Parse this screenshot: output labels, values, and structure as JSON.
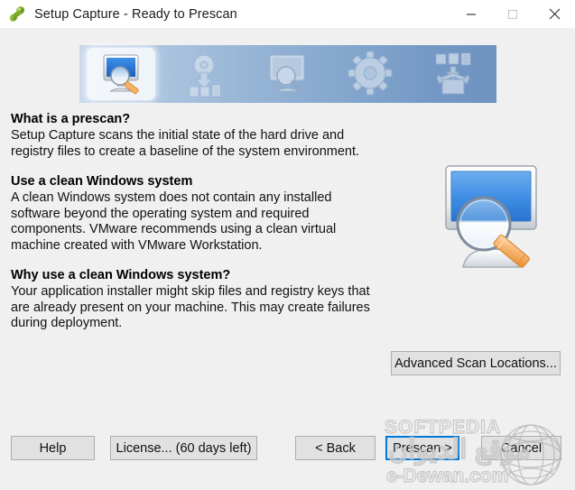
{
  "window": {
    "title": "Setup Capture - Ready to Prescan",
    "app_icon": "capture-peanut-icon",
    "controls": {
      "minimize": "minimize-icon",
      "maximize": "maximize-icon",
      "close": "close-icon"
    }
  },
  "banner": {
    "steps": [
      {
        "id": "prescan",
        "icon": "monitor-magnifier-pencil-icon",
        "active": true
      },
      {
        "id": "install",
        "icon": "disc-download-files-icon",
        "active": false
      },
      {
        "id": "postscan",
        "icon": "monitor-magnifier-icon",
        "active": false
      },
      {
        "id": "configure",
        "icon": "gear-icon",
        "active": false
      },
      {
        "id": "package",
        "icon": "box-files-icon",
        "active": false
      }
    ]
  },
  "content": {
    "sections": [
      {
        "heading": "What is a prescan?",
        "body": "Setup Capture scans the initial state of the hard drive and registry files to create a baseline of the system environment."
      },
      {
        "heading": "Use a clean Windows system",
        "body": "A clean Windows system does not contain any installed software beyond the operating system and required components. VMware recommends using a clean virtual machine created with VMware Workstation."
      },
      {
        "heading": "Why use a clean Windows system?",
        "body": "Your application installer might skip files and registry keys that are already present on your machine. This may create failures during deployment."
      }
    ],
    "hero_icon": "monitor-magnifier-pencil-large-icon"
  },
  "buttons": {
    "advanced_scan_locations": "Advanced Scan Locations...",
    "help": "Help",
    "license": "License... (60 days left)",
    "back": "< Back",
    "prescan": "Prescan >",
    "cancel": "Cancel"
  },
  "focus": {
    "element": "prescan-button",
    "color": "#0078d7"
  },
  "watermark": {
    "brand": "SOFTPEDIA",
    "site": "e-Dewan.com",
    "logo": "globe-icon"
  },
  "colors": {
    "window_background": "#f0f0f0",
    "titlebar_background": "#ffffff",
    "banner_left": "#c9d8ea",
    "banner_right": "#6e93c1",
    "button_face": "#e1e1e1",
    "button_border": "#adadad",
    "focus_border": "#0078d7",
    "text": "#111111",
    "icon_green": "#7aa82c",
    "screen_blue": "#2f7fd8",
    "pencil_orange": "#f4a85a"
  }
}
